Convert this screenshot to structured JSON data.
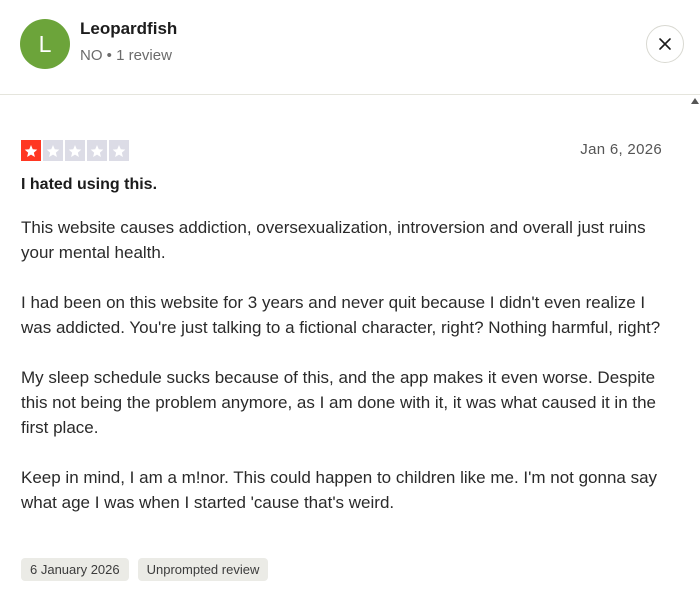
{
  "reviewer": {
    "avatar_initial": "L",
    "avatar_color": "#6ca43a",
    "name": "Leopardfish",
    "meta": "NO • 1 review"
  },
  "dialog": {
    "close_icon": "close-icon"
  },
  "review": {
    "rating": 1,
    "rating_max": 5,
    "star_color": "#ff3722",
    "date": "Jan 6, 2026",
    "title": "I hated using this.",
    "paragraphs": [
      "This website causes addiction, oversexualization, introversion and overall just ruins your mental health.",
      "I had been on this website for 3 years and never quit because I didn't even realize I was addicted. You're just talking to a fictional character, right? Nothing harmful, right?",
      "My sleep schedule sucks because of this, and the app makes it even worse. Despite this not being the problem anymore, as I am done with it, it was what caused it in the first place.",
      "Keep in mind, I am a m!nor. This could happen to children like me. I'm not gonna say what age I was when I started 'cause that's weird."
    ],
    "tags": [
      "6 January 2026",
      "Unprompted review"
    ]
  }
}
